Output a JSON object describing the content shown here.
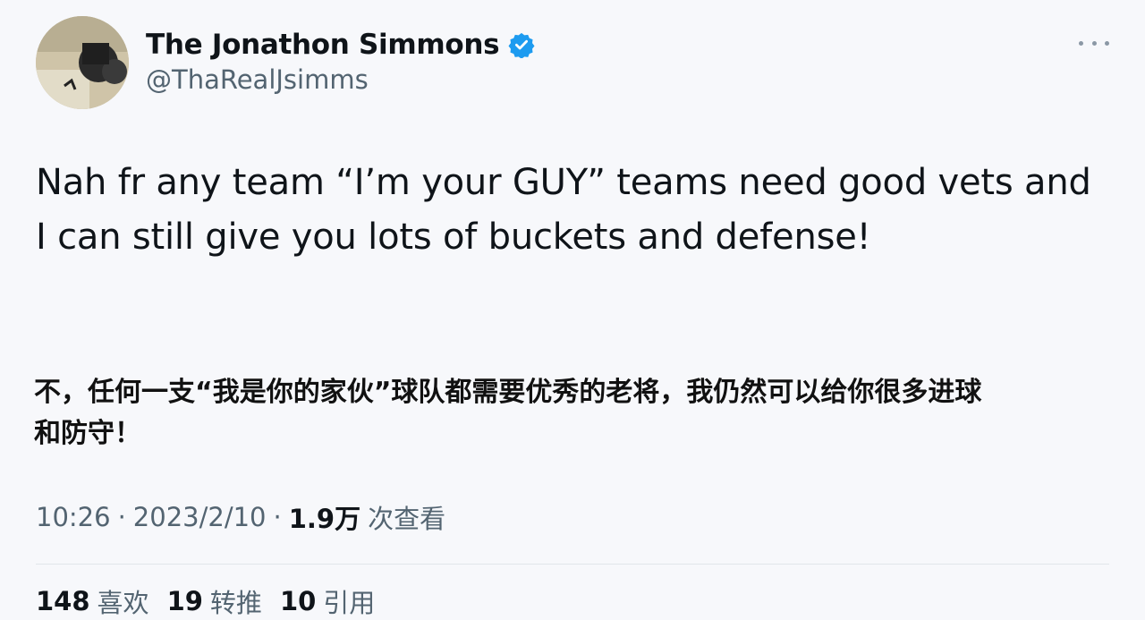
{
  "user": {
    "display_name": "The Jonathon Simmons",
    "handle": "@ThaRealJsimms",
    "verified": true,
    "verified_color": "#1d9bf0"
  },
  "tweet": {
    "text_line1": "Nah fr any team “I’m your GUY” teams need good vets and",
    "text_line2": "I can still give you lots of buckets and defense!",
    "translation_line1": "不，任何一支“我是你的家伙”球队都需要优秀的老将，我仍然可以给你很多进球",
    "translation_line2": "和防守！"
  },
  "meta": {
    "time": "10:26",
    "separator": "·",
    "date": "2023/2/10",
    "views_count": "1.9万",
    "views_label": "次查看"
  },
  "stats": [
    {
      "num": "148",
      "label": "喜欢"
    },
    {
      "num": "19",
      "label": "转推"
    },
    {
      "num": "10",
      "label": "引用"
    }
  ],
  "icons": {
    "more": "more-options-icon",
    "verified": "verified-badge-icon"
  }
}
